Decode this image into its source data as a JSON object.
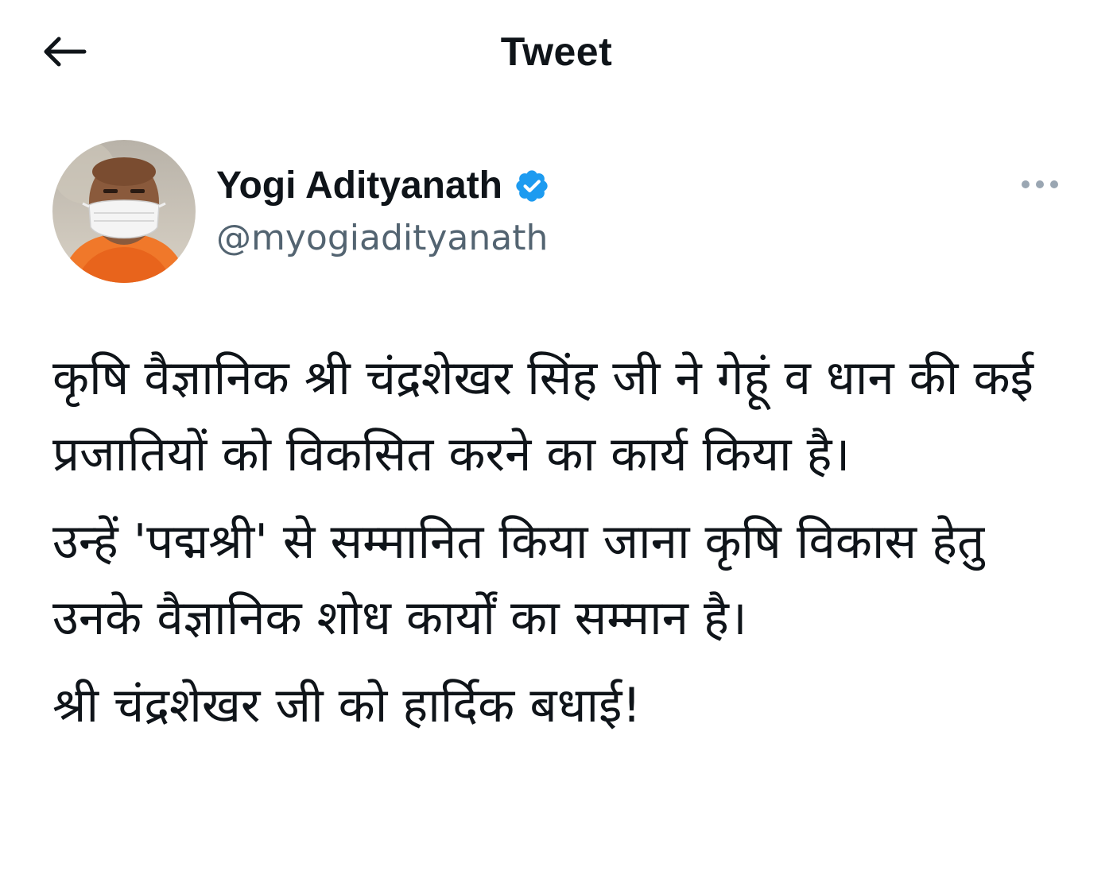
{
  "header": {
    "title": "Tweet",
    "back_icon": "arrow-left-icon"
  },
  "author": {
    "display_name": "Yogi Adityanath",
    "handle": "@myogiadityanath",
    "verified": true,
    "verified_icon": "verified-badge-icon",
    "avatar_icon": "avatar-photo",
    "more_icon": "more-horizontal-icon"
  },
  "tweet": {
    "paragraphs": [
      "कृषि वैज्ञानिक श्री चंद्रशेखर सिंह जी ने गेहूं व धान की कई प्रजातियों को विकसित करने का कार्य किया है।",
      "उन्हें 'पद्मश्री' से सम्मानित किया जाना कृषि विकास हेतु उनके वैज्ञानिक शोध कार्यों का सम्मान है।",
      "श्री चंद्रशेखर जी को हार्दिक बधाई!"
    ]
  },
  "colors": {
    "text": "#0f1419",
    "secondary": "#536471",
    "accent": "#1d9bf0",
    "background": "#ffffff",
    "more_dots": "#9aa6b2"
  }
}
